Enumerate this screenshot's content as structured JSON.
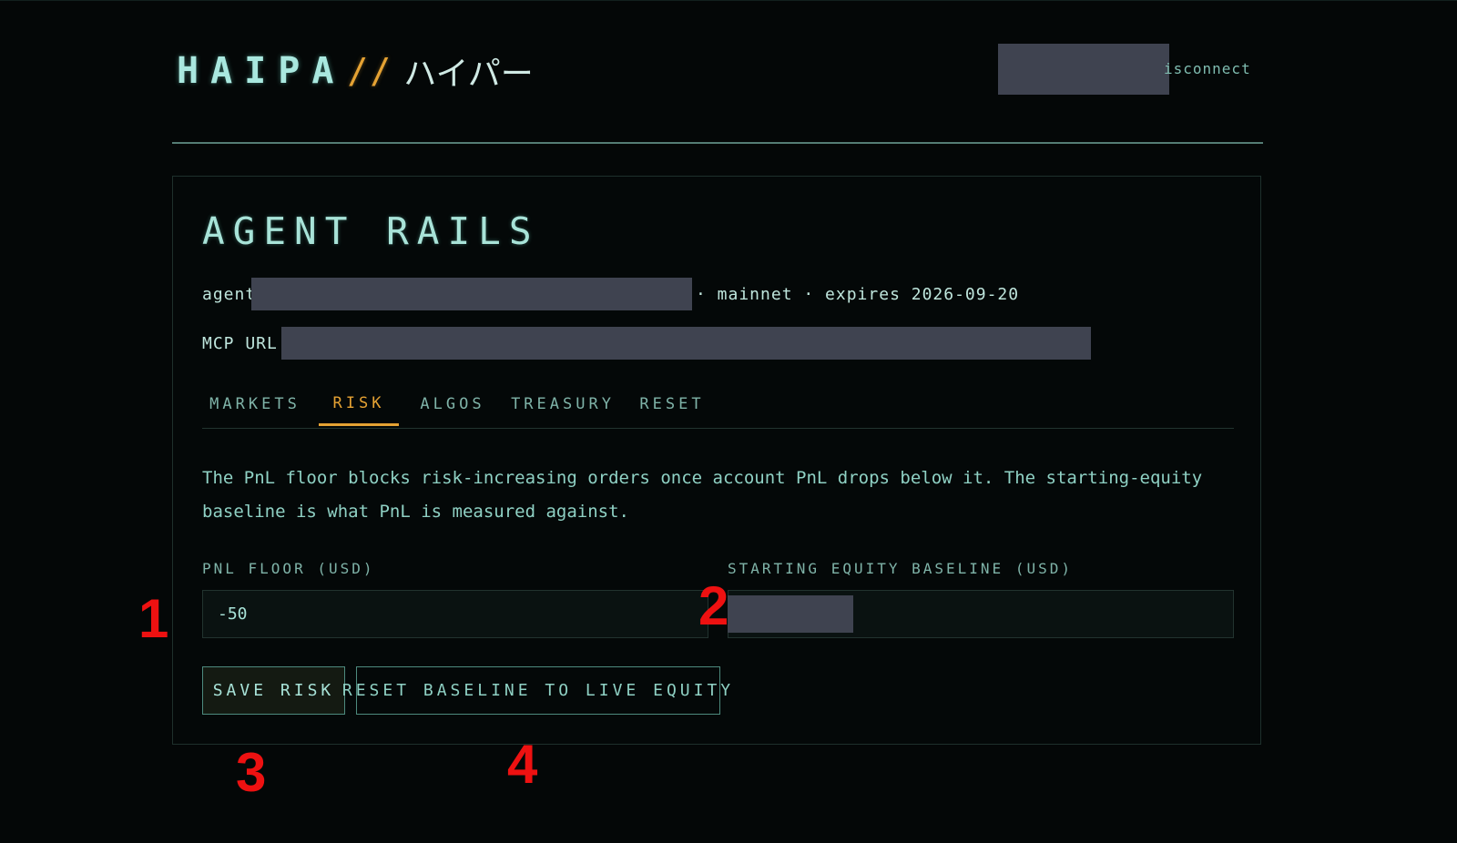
{
  "header": {
    "brand": "HAIPA",
    "brand_separator": "//",
    "brand_jp": "ハイパー",
    "disconnect_label": "isconnect"
  },
  "panel": {
    "title": "AGENT RAILS",
    "agent_prefix": "agent",
    "agent_suffix": "· mainnet · expires 2026-09-20",
    "mcp_label": "MCP URL:"
  },
  "tabs": [
    {
      "label": "MARKETS",
      "active": false
    },
    {
      "label": "RISK",
      "active": true
    },
    {
      "label": "ALGOS",
      "active": false
    },
    {
      "label": "TREASURY",
      "active": false
    },
    {
      "label": "RESET",
      "active": false
    }
  ],
  "risk": {
    "description": "The PnL floor blocks risk-increasing orders once account PnL drops below it. The starting-equity baseline is what PnL is measured against.",
    "pnl_floor_label": "PNL FLOOR (USD)",
    "pnl_floor_value": "-50",
    "baseline_label": "STARTING EQUITY BASELINE (USD)",
    "save_label": "SAVE RISK",
    "reset_label": "RESET BASELINE TO LIVE EQUITY"
  },
  "annotations": [
    "1",
    "2",
    "3",
    "4"
  ],
  "colors": {
    "background": "#040707",
    "accent": "#e5a233",
    "text": "#a8e3d8",
    "redaction": "#3f4350",
    "marker": "#ee1111"
  }
}
